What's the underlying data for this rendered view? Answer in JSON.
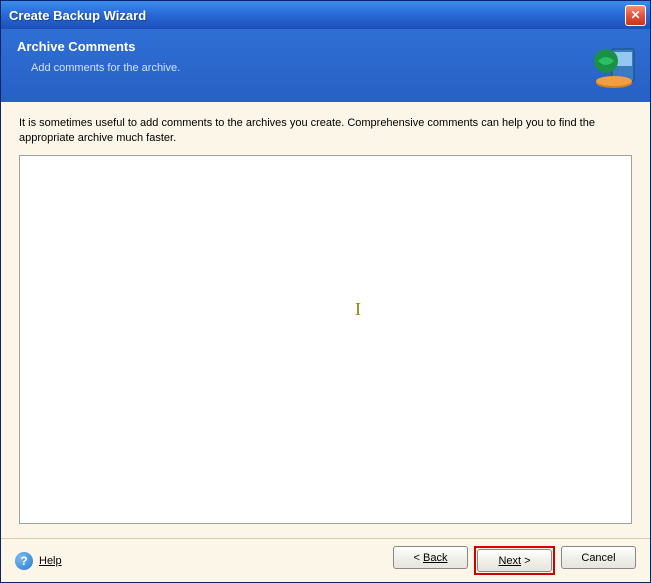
{
  "window": {
    "title": "Create Backup Wizard"
  },
  "header": {
    "title": "Archive Comments",
    "subtitle": "Add comments for the archive."
  },
  "content": {
    "intro": "It is sometimes useful to add comments to the archives you create. Comprehensive comments can help you to find the appropriate archive much faster.",
    "textarea_value": ""
  },
  "footer": {
    "help_label": "Help",
    "back_label": "Back",
    "back_prefix": "< ",
    "next_label": "Next",
    "next_suffix": " >",
    "cancel_label": "Cancel"
  }
}
